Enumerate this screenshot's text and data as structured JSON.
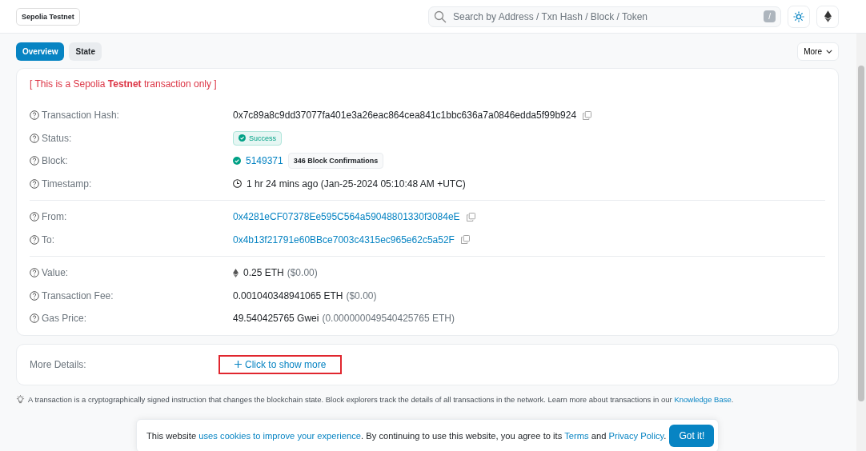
{
  "network_badge": "Sepolia Testnet",
  "search": {
    "placeholder": "Search by Address / Txn Hash / Block / Token",
    "shortcut": "/"
  },
  "tabs": [
    {
      "label": "Overview",
      "selected": true
    },
    {
      "label": "State",
      "selected": false
    }
  ],
  "more_button": "More",
  "testnet_notice": "[ This is a Sepolia **Testnet** transaction only ]",
  "sections": [
    [
      {
        "kind": "hash",
        "label": "Transaction Hash:",
        "value": "0x7c89a8c9dd37077fa401e3a26eac864cea841c1bbc636a7a0846edda5f99b924"
      },
      {
        "kind": "status",
        "label": "Status:",
        "value": "Success"
      },
      {
        "kind": "block",
        "label": "Block:",
        "value": "5149371",
        "confirmations": "346 Block Confirmations"
      },
      {
        "kind": "timestamp",
        "label": "Timestamp:",
        "value": "1 hr 24 mins ago (Jan-25-2024 05:10:48 AM +UTC)"
      }
    ],
    [
      {
        "kind": "address",
        "label": "From:",
        "value": "0x4281eCF07378Ee595C564a59048801330f3084eE"
      },
      {
        "kind": "address",
        "label": "To:",
        "value": "0x4b13f21791e60BBce7003c4315ec965e62c5a52F"
      }
    ],
    [
      {
        "kind": "eth",
        "label": "Value:",
        "value": "0.25 ETH",
        "note": "($0.00)"
      },
      {
        "kind": "amount",
        "label": "Transaction Fee:",
        "value": "0.001040348941065 ETH",
        "note": "($0.00)"
      },
      {
        "kind": "amount",
        "label": "Gas Price:",
        "value": "49.540425765 Gwei",
        "note": "(0.000000049540425765 ETH)"
      }
    ]
  ],
  "more_details": {
    "label": "More Details:",
    "link": "Click to show more",
    "highlighted": true
  },
  "footnote": {
    "text": "A transaction is a cryptographically signed instruction that changes the blockchain state. Block explorers track the details of all transactions in the network. Learn more about transactions in our",
    "link": "Knowledge Base",
    "end": "."
  },
  "cookie_banner": {
    "text_start": "This website",
    "cookies_link": "uses cookies to improve your experience",
    "text_middle": ". By continuing to use this website, you agree to its",
    "terms_link": "Terms",
    "conjunction": "and",
    "privacy_link": "Privacy Policy",
    "text_end": ".",
    "button": "Got it!"
  }
}
